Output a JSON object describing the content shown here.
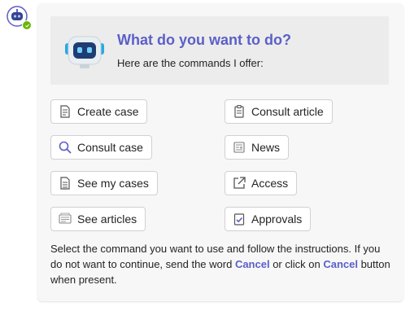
{
  "bot": {
    "avatar_icon": "robot-icon",
    "presence": "available"
  },
  "hero": {
    "title": "What do you want to do?",
    "subtitle": "Here are the commands I offer:"
  },
  "commands": [
    {
      "label": "Create case",
      "icon": "document-add-icon"
    },
    {
      "label": "Consult article",
      "icon": "clipboard-icon"
    },
    {
      "label": "Consult case",
      "icon": "search-icon"
    },
    {
      "label": "News",
      "icon": "news-icon"
    },
    {
      "label": "See my cases",
      "icon": "document-icon"
    },
    {
      "label": "Access",
      "icon": "open-external-icon"
    },
    {
      "label": "See articles",
      "icon": "articles-icon"
    },
    {
      "label": "Approvals",
      "icon": "approval-icon"
    }
  ],
  "footer": {
    "text_1": "Select the command you want to use and follow the instructions. If you do not want to continue, send the word ",
    "link_1": "Cancel",
    "text_2": " or click on ",
    "link_2": "Cancel",
    "text_3": " button when present."
  },
  "colors": {
    "accent": "#5b5fc7",
    "presence": "#6bb700",
    "card_bg": "#f7f7f7",
    "hero_bg": "#ececec"
  }
}
